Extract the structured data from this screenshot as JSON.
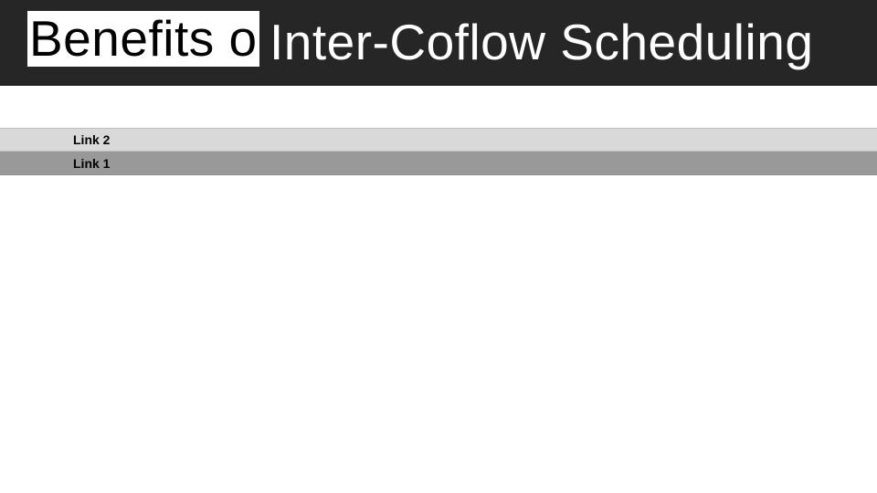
{
  "title": {
    "part_a": "Benefits o",
    "part_b": "Inter-Coflow Scheduling"
  },
  "links": {
    "top": "Link 2",
    "bottom": "Link 1"
  }
}
